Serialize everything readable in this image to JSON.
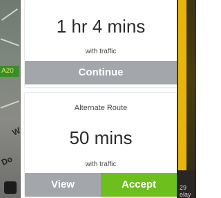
{
  "map": {
    "road_tag": "A20",
    "label_w": "W",
    "label_do": "Do",
    "right_bottom_top": "29",
    "right_bottom_bottom": "elay"
  },
  "primary_route": {
    "duration": "1 hr 4 mins",
    "subtitle": "with traffic",
    "continue_label": "Continue"
  },
  "alternate_route": {
    "title": "Alternate Route",
    "duration": "50 mins",
    "subtitle": "with traffic",
    "view_label": "View",
    "accept_label": "Accept"
  },
  "colors": {
    "accept": "#6dbf1d",
    "neutral_button": "#a3a6aa",
    "text": "#2b2b2b"
  }
}
